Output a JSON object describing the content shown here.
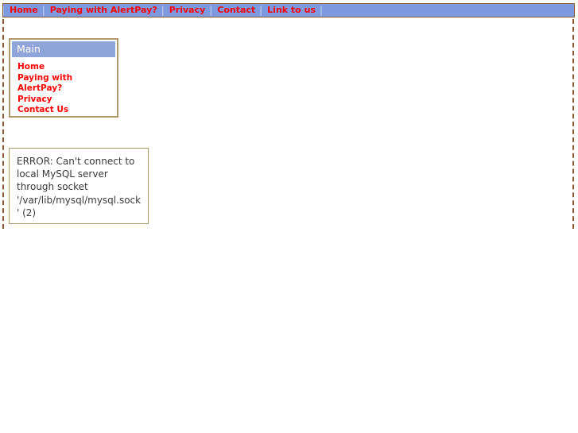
{
  "topnav": {
    "separator": "|",
    "links": [
      {
        "label": "Home"
      },
      {
        "label": "Paying with AlertPay?"
      },
      {
        "label": "Privacy"
      },
      {
        "label": "Contact"
      },
      {
        "label": "Link to us"
      }
    ],
    "background_color": "#7d9ae0",
    "link_color": "#ff0000",
    "border_color": "#8b5a33"
  },
  "sidebar": {
    "header_title": "Main",
    "header_color": "#8fa5da",
    "border_color": "#b09a6b",
    "link_color": "#ff0000",
    "items": [
      {
        "label": "Home"
      },
      {
        "label": "Paying with AlertPay?"
      },
      {
        "label": "Privacy"
      },
      {
        "label": "Contact Us"
      }
    ]
  },
  "error_panel": {
    "message": "ERROR: Can't connect to local MySQL server through socket '/var/lib/mysql/mysql.sock' (2)",
    "border_color": "#b09a6b",
    "text_color": "#3a3a3a"
  },
  "page": {
    "frame_border_color": "#8b5a33",
    "background_color": "#ffffff"
  }
}
